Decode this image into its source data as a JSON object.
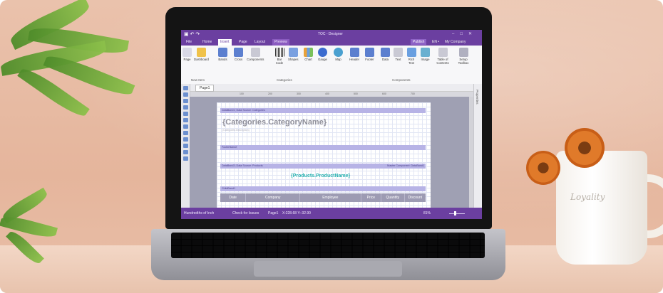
{
  "window": {
    "title": "TOC - Designer"
  },
  "menu": {
    "tabs": [
      "File",
      "Home",
      "Insert",
      "Page",
      "Layout",
      "Preview"
    ],
    "active_tab": "Insert",
    "publish": "Publish",
    "language": "EN",
    "company": "My Company"
  },
  "ribbon": {
    "buttons": [
      "Page",
      "Dashboard",
      "Bands",
      "Cross",
      "Components",
      "Bar Code",
      "Shapes",
      "Chart",
      "Gauge",
      "Map",
      "Header",
      "Footer",
      "Data",
      "Text",
      "Rich Text",
      "Image",
      "Table of Contents",
      "Setup Toolbox"
    ],
    "groups": {
      "new_item": "New Item",
      "categories": "Categories",
      "components": "Components"
    }
  },
  "doc_tab": "Page1",
  "ruler_ticks": [
    "100",
    "200",
    "300",
    "400",
    "500",
    "600",
    "700"
  ],
  "right_panel_label": "Properties",
  "report": {
    "band1": "DataBand1; Data Source: Categories",
    "category_field": "{Categories.CategoryName}",
    "category_desc": "{Categories.Description}",
    "footer_band": "FooterBand2",
    "band2": "DataBand3; Data Source: Products",
    "band2_right": "Master Component: DataBand1",
    "product_field": "{Products.ProductName}",
    "child_band": "ChildBand1",
    "headers": [
      "Date",
      "Company",
      "Employee",
      "Price",
      "Quantity",
      "Discount"
    ]
  },
  "status": {
    "units": "Hundredths of Inch",
    "check": "Check for Issues",
    "page": "Page1",
    "coords": "X:228.68 Y:-32.90",
    "zoom": "81%"
  },
  "decor": {
    "mug_text": "Loyality"
  },
  "colors": {
    "accent": "#6b3fa0",
    "band": "#b7b3e6",
    "product_field": "#2bb3b1"
  }
}
